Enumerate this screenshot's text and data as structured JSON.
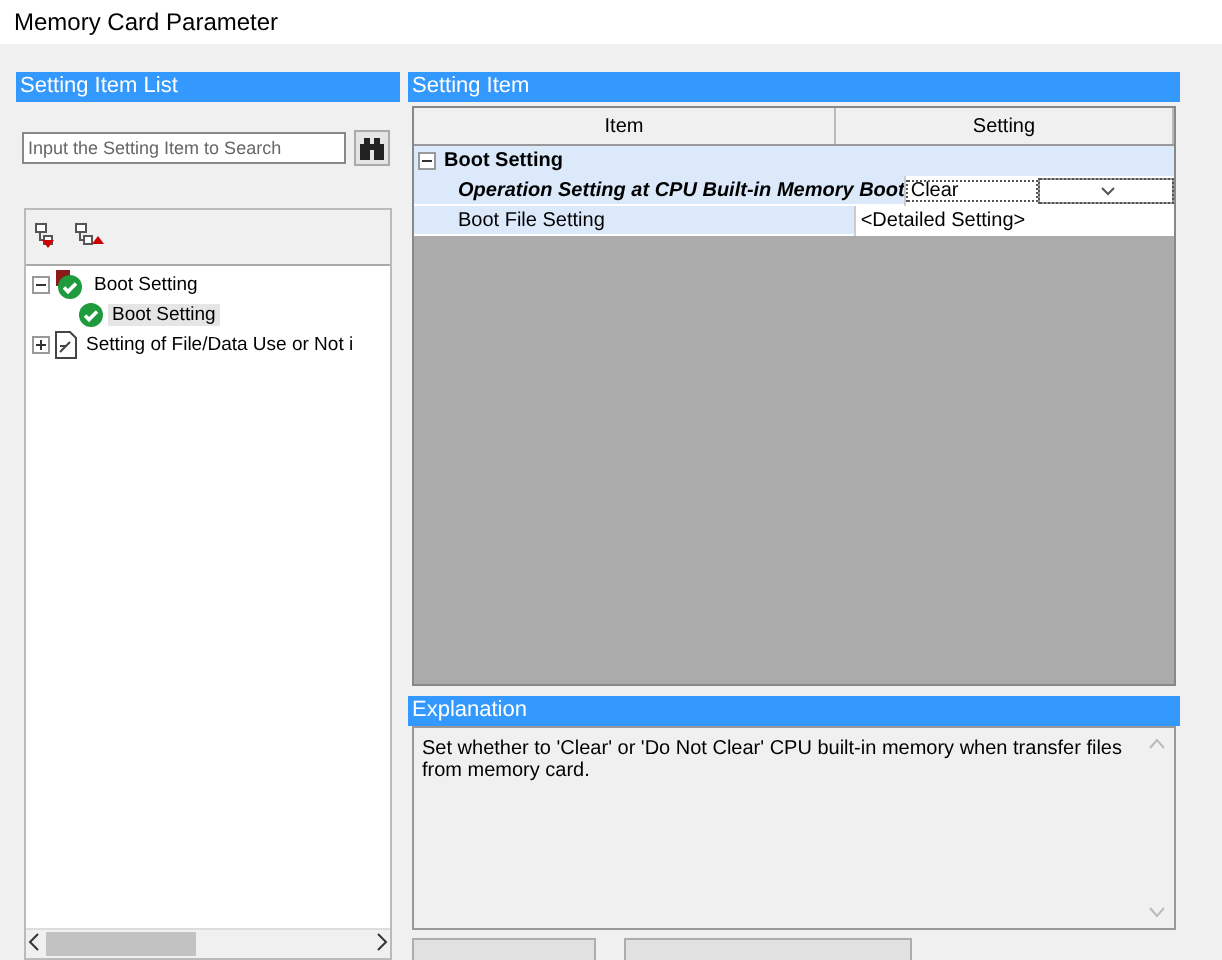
{
  "window": {
    "title": "Memory Card Parameter"
  },
  "left_panel": {
    "title": "Setting Item List",
    "search": {
      "placeholder": "Input the Setting Item to Search"
    },
    "tree": [
      {
        "label": "Boot Setting",
        "kind": "folder",
        "expanded": true,
        "selected": false,
        "children": [
          {
            "label": "Boot Setting",
            "kind": "setting",
            "selected": true
          }
        ]
      },
      {
        "label": "Setting of File/Data Use or Not i",
        "kind": "document",
        "expanded": false,
        "selected": false
      }
    ]
  },
  "setting_panel": {
    "title": "Setting Item",
    "columns": [
      "Item",
      "Setting"
    ],
    "groups": [
      {
        "label": "Boot Setting",
        "expanded": true,
        "items": [
          {
            "label": "Operation Setting at CPU Built-in Memory Boot",
            "kind": "dropdown",
            "value": "Clear",
            "modified": true,
            "selected": true
          },
          {
            "label": "Boot File Setting",
            "kind": "detail",
            "value": "<Detailed Setting>",
            "modified": false,
            "selected": false
          }
        ]
      }
    ]
  },
  "explanation": {
    "title": "Explanation",
    "text": "Set whether to 'Clear' or 'Do Not Clear' CPU built-in memory when transfer files from memory card."
  }
}
